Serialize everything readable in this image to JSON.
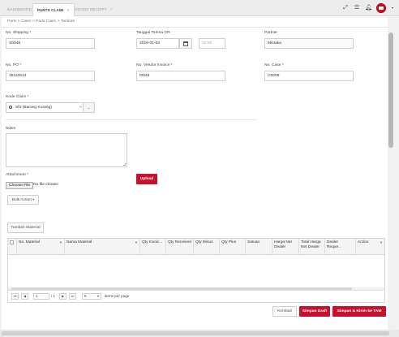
{
  "tabs": [
    {
      "label": "DASHBOARD",
      "active": false,
      "closable": false
    },
    {
      "label": "PARTS CLAIM",
      "active": true,
      "closable": true
    },
    {
      "label": "GOODS RECEIPT",
      "active": false,
      "closable": true
    }
  ],
  "top_icons": [
    "expand-icon",
    "menu-icon",
    "bell-icon",
    "user-avatar-icon"
  ],
  "breadcrumb": "Parts > Claim > Parts Claim > Tambah",
  "form": {
    "no_shipping": {
      "label": "No. Shipping *",
      "value": "S0048"
    },
    "tanggal_terima_gr": {
      "label": "Tanggal Terima GR",
      "date": "2019-01-03",
      "time_placeholder": "00:00"
    },
    "partner": {
      "label": "Partner",
      "value": "Mistaka"
    },
    "no_po": {
      "label": "No. PO *",
      "value": "18110514"
    },
    "no_vendor_invoice": {
      "label": "No. Vendor Invoice *",
      "value": "I0048"
    },
    "no_case": {
      "label": "No. Case *",
      "value": "C0008"
    },
    "kode_claim": {
      "label": "Kode Claim *",
      "value": "Sht (Barang Kurang)"
    },
    "notes": {
      "label": "Notes",
      "value": ""
    },
    "attachment": {
      "label": "Attachment *",
      "choose_label": "Choose File",
      "status": "No file chosen",
      "upload_label": "Upload"
    }
  },
  "bulk_action_label": "Bulk Action",
  "tambah_material_label": "Tambah Material",
  "grid": {
    "columns": [
      "No. Material",
      "Nama Material",
      "Qty Invoic...",
      "Qty Received",
      "Qty Minus",
      "Qty Plus",
      "Satuan",
      "Harga Net Dealer",
      "Total Harga Net Dealer",
      "Dealer Reque...",
      "Action"
    ],
    "rows": [],
    "pager": {
      "page": "1",
      "of": "/ 1",
      "page_size": "5",
      "per_page_label": "items per page"
    }
  },
  "footer": {
    "kembali_label": "Kembali",
    "draft_label": "Simpan Draft",
    "send_label": "Simpan & Kirim ke TAM"
  },
  "colors": {
    "accent": "#c8102e",
    "border": "#cfcfcf"
  }
}
